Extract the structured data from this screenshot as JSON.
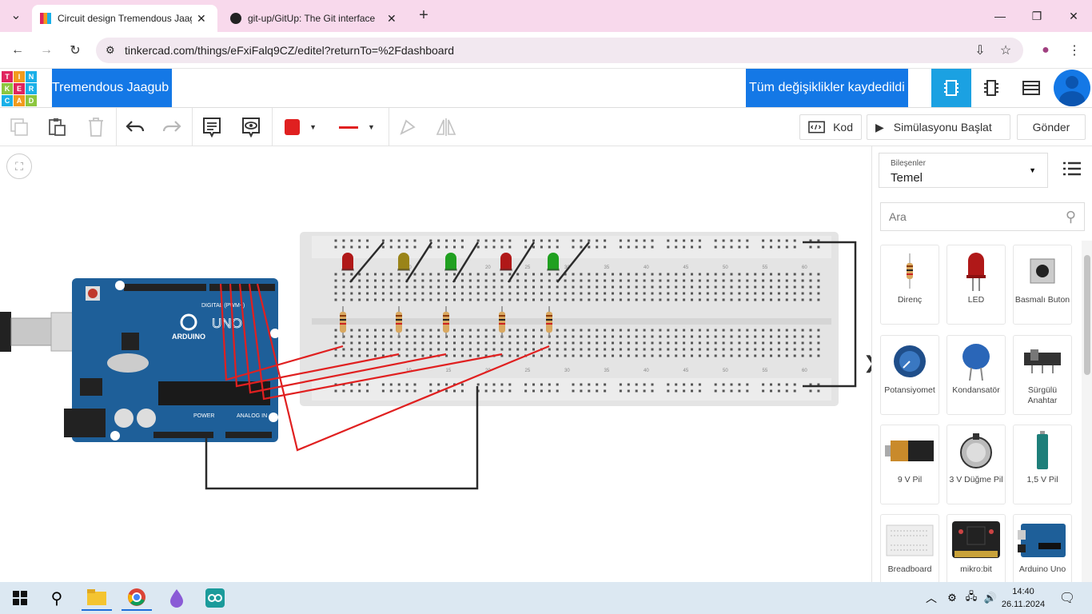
{
  "browser": {
    "tabs": [
      {
        "title": "Circuit design Tremendous Jaag",
        "active": true
      },
      {
        "title": "git-up/GitUp: The Git interface",
        "active": false
      }
    ],
    "url": "tinkercad.com/things/eFxiFalq9CZ/editel?returnTo=%2Fdashboard"
  },
  "app": {
    "logo_letters": [
      "T",
      "I",
      "N",
      "K",
      "E",
      "R",
      "C",
      "A",
      "D"
    ],
    "design_name": "Tremendous Jaagub",
    "save_status": "Tüm değişiklikler kaydedildi"
  },
  "toolbar": {
    "code_label": "Kod",
    "simulate_label": "Simülasyonu Başlat",
    "send_label": "Gönder",
    "wire_color": "#e02020"
  },
  "panel": {
    "components_label": "Bileşenler",
    "components_value": "Temel",
    "search_placeholder": "Ara",
    "items": [
      {
        "label": "Direnç",
        "icon": "resistor-icon"
      },
      {
        "label": "LED",
        "icon": "led-icon"
      },
      {
        "label": "Basmalı Buton",
        "icon": "pushbutton-icon"
      },
      {
        "label": "Potansiyomet",
        "icon": "potentiometer-icon"
      },
      {
        "label": "Kondansatör",
        "icon": "capacitor-icon"
      },
      {
        "label": "Sürgülü Anahtar",
        "icon": "slide-switch-icon"
      },
      {
        "label": "9 V Pil",
        "icon": "battery-9v-icon"
      },
      {
        "label": "3 V Düğme Pil",
        "icon": "coin-cell-icon"
      },
      {
        "label": "1,5 V Pil",
        "icon": "battery-aa-icon"
      },
      {
        "label": "Breadboard",
        "icon": "breadboard-icon"
      },
      {
        "label": "mikro:bit",
        "icon": "microbit-icon"
      },
      {
        "label": "Arduino Uno",
        "icon": "arduino-uno-icon"
      }
    ]
  },
  "circuit": {
    "arduino_text": "ARDUINO",
    "uno_text": "UNO",
    "digital_label": "DIGITAL (PWM~)",
    "analog_label": "ANALOG IN",
    "power_label": "POWER",
    "leds": [
      "#b01818",
      "#9a8418",
      "#20a020",
      "#b01818",
      "#20a020"
    ],
    "breadboard_numbers": [
      "10",
      "15",
      "20",
      "25",
      "30",
      "35",
      "40",
      "45",
      "50",
      "55",
      "60"
    ]
  },
  "taskbar": {
    "time": "14:40",
    "date": "26.11.2024"
  }
}
